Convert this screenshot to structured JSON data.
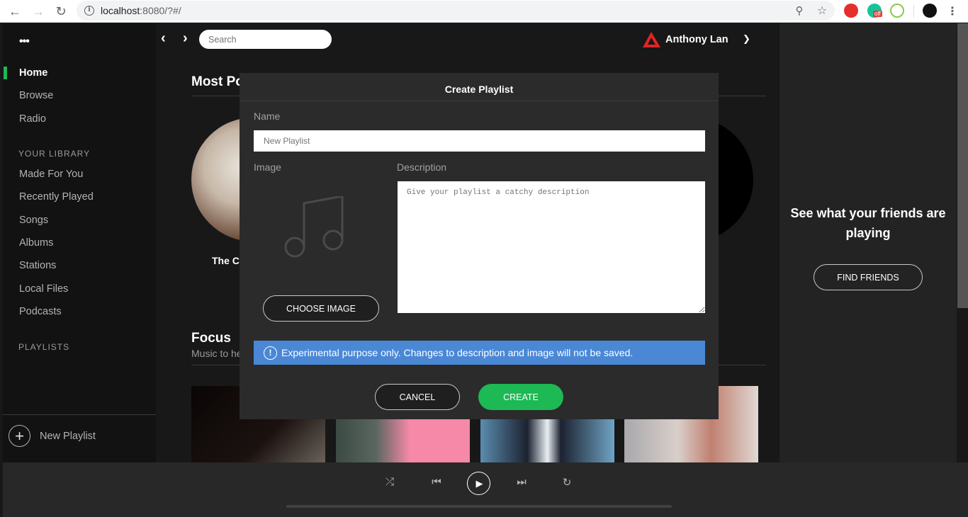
{
  "browser": {
    "url_host": "localhost",
    "url_rest": ":8080/?#/",
    "extensions": [
      "adblock-icon",
      "grammarly-icon",
      "nodejs-icon"
    ],
    "grammarly_badge": "off"
  },
  "sidebar": {
    "menu_icon": "more-icon",
    "nav": [
      {
        "label": "Home",
        "active": true
      },
      {
        "label": "Browse",
        "active": false
      },
      {
        "label": "Radio",
        "active": false
      }
    ],
    "library_title": "YOUR LIBRARY",
    "library": [
      "Made For You",
      "Recently Played",
      "Songs",
      "Albums",
      "Stations",
      "Local Files",
      "Podcasts"
    ],
    "playlists_title": "PLAYLISTS",
    "new_playlist_label": "New Playlist"
  },
  "header": {
    "search_placeholder": "Search",
    "user_name": "Anthony Lan"
  },
  "main": {
    "section1_title": "Most Po",
    "artist_name": "The Cl",
    "section2_title": "Focus",
    "section2_subtitle": "Music to he"
  },
  "friends": {
    "title": "See what your friends are playing",
    "button": "FIND FRIENDS"
  },
  "player": {
    "controls": [
      "shuffle",
      "previous",
      "play",
      "next",
      "repeat"
    ]
  },
  "modal": {
    "title": "Create Playlist",
    "name_label": "Name",
    "name_placeholder": "New Playlist",
    "image_label": "Image",
    "description_label": "Description",
    "description_placeholder": "Give your playlist a catchy description",
    "choose_image": "CHOOSE IMAGE",
    "alert": "Experimental purpose only. Changes to description and image will not be saved.",
    "cancel": "CANCEL",
    "create": "CREATE"
  },
  "colors": {
    "accent": "#1db954",
    "alert": "#4a88d6",
    "sidebar_bg": "#121212",
    "modal_bg": "#2b2b2b"
  }
}
